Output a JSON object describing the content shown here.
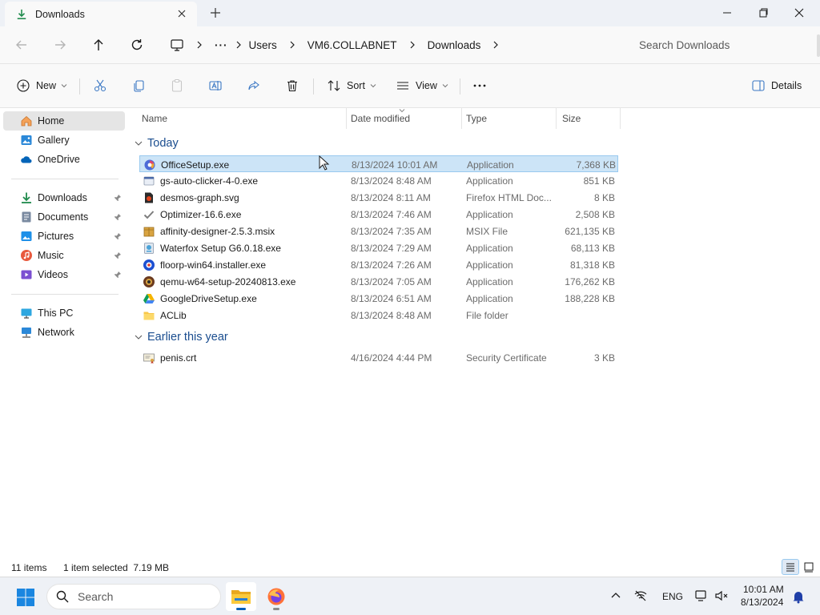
{
  "window": {
    "tab_title": "Downloads",
    "controls": [
      "minimize-icon",
      "maximize-icon",
      "close-icon"
    ]
  },
  "address": {
    "breadcrumb": [
      "Users",
      "VM6.COLLABNET",
      "Downloads"
    ],
    "search_placeholder": "Search Downloads"
  },
  "toolbar": {
    "new_label": "New",
    "sort_label": "Sort",
    "view_label": "View",
    "details_label": "Details"
  },
  "sidebar": {
    "items": [
      {
        "label": "Home",
        "icon": "home-icon",
        "selected": true
      },
      {
        "label": "Gallery",
        "icon": "gallery-icon"
      },
      {
        "label": "OneDrive",
        "icon": "onedrive-icon"
      },
      {
        "label": "Downloads",
        "icon": "downloads-icon",
        "pinned": true
      },
      {
        "label": "Documents",
        "icon": "documents-icon",
        "pinned": true
      },
      {
        "label": "Pictures",
        "icon": "pictures-icon",
        "pinned": true
      },
      {
        "label": "Music",
        "icon": "music-icon",
        "pinned": true
      },
      {
        "label": "Videos",
        "icon": "videos-icon",
        "pinned": true
      },
      {
        "label": "This PC",
        "icon": "this-pc-icon"
      },
      {
        "label": "Network",
        "icon": "network-icon"
      }
    ]
  },
  "columns": {
    "name": "Name",
    "date": "Date modified",
    "type": "Type",
    "size": "Size"
  },
  "groups": [
    {
      "title": "Today",
      "files": [
        {
          "name": "OfficeSetup.exe",
          "date": "8/13/2024 10:01 AM",
          "type": "Application",
          "size": "7,368 KB",
          "icon": "office-setup-icon",
          "selected": true
        },
        {
          "name": "gs-auto-clicker-4-0.exe",
          "date": "8/13/2024 8:48 AM",
          "type": "Application",
          "size": "851 KB",
          "icon": "app-icon"
        },
        {
          "name": "desmos-graph.svg",
          "date": "8/13/2024 8:11 AM",
          "type": "Firefox HTML Doc...",
          "size": "8 KB",
          "icon": "svg-file-icon"
        },
        {
          "name": "Optimizer-16.6.exe",
          "date": "8/13/2024 7:46 AM",
          "type": "Application",
          "size": "2,508 KB",
          "icon": "checkmark-app-icon"
        },
        {
          "name": "affinity-designer-2.5.3.msix",
          "date": "8/13/2024 7:35 AM",
          "type": "MSIX File",
          "size": "621,135 KB",
          "icon": "package-icon"
        },
        {
          "name": "Waterfox Setup G6.0.18.exe",
          "date": "8/13/2024 7:29 AM",
          "type": "Application",
          "size": "68,113 KB",
          "icon": "installer-icon"
        },
        {
          "name": "floorp-win64.installer.exe",
          "date": "8/13/2024 7:26 AM",
          "type": "Application",
          "size": "81,318 KB",
          "icon": "floorp-icon"
        },
        {
          "name": "qemu-w64-setup-20240813.exe",
          "date": "8/13/2024 7:05 AM",
          "type": "Application",
          "size": "176,262 KB",
          "icon": "qemu-icon"
        },
        {
          "name": "GoogleDriveSetup.exe",
          "date": "8/13/2024 6:51 AM",
          "type": "Application",
          "size": "188,228 KB",
          "icon": "google-drive-icon"
        },
        {
          "name": "ACLib",
          "date": "8/13/2024 8:48 AM",
          "type": "File folder",
          "size": "",
          "icon": "folder-icon"
        }
      ]
    },
    {
      "title": "Earlier this year",
      "files": [
        {
          "name": "penis.crt",
          "date": "4/16/2024 4:44 PM",
          "type": "Security Certificate",
          "size": "3 KB",
          "icon": "certificate-icon"
        }
      ]
    }
  ],
  "status": {
    "item_count": "11 items",
    "selection": "1 item selected  7.19 MB"
  },
  "taskbar": {
    "search_label": "Search",
    "language": "ENG",
    "time": "10:01 AM",
    "date": "8/13/2024"
  },
  "colors": {
    "accent": "#005fb8",
    "selection": "#cce4f7",
    "group_header": "#1a4d8f"
  }
}
